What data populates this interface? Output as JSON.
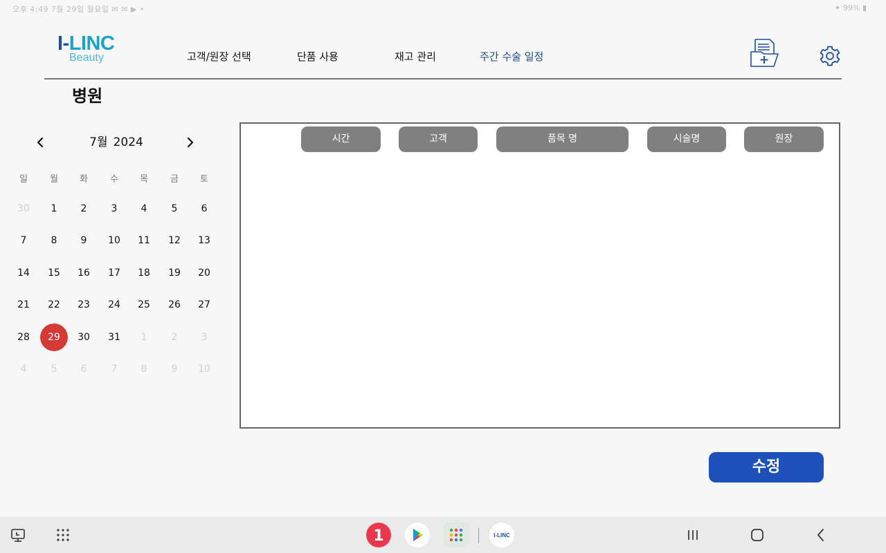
{
  "status_bar": {
    "left_text": "오후 4:49  7월 29일 월요일  ✉ ✉ ▶ •",
    "right_text": "✦ 99% ▮"
  },
  "logo": {
    "main_dark": "I-",
    "main_light": "LINC",
    "sub": "Beauty"
  },
  "nav": {
    "items": [
      {
        "label": "고객/원장 선택"
      },
      {
        "label": "단품 사용"
      },
      {
        "label": "재고 관리"
      },
      {
        "label": "주간 수술 일정"
      }
    ],
    "active_index": 3
  },
  "header_icons": [
    "medical-document-icon",
    "gear-icon"
  ],
  "page": {
    "title": "병원"
  },
  "calendar": {
    "month_label": "7월",
    "year_label": "2024",
    "weekdays": [
      "일",
      "월",
      "화",
      "수",
      "목",
      "금",
      "토"
    ],
    "weeks": [
      [
        "30",
        "1",
        "2",
        "3",
        "4",
        "5",
        "6"
      ],
      [
        "7",
        "8",
        "9",
        "10",
        "11",
        "12",
        "13"
      ],
      [
        "14",
        "15",
        "16",
        "17",
        "18",
        "19",
        "20"
      ],
      [
        "21",
        "22",
        "23",
        "24",
        "25",
        "26",
        "27"
      ],
      [
        "28",
        "29",
        "30",
        "31",
        "1",
        "2",
        "3"
      ],
      [
        "4",
        "5",
        "6",
        "7",
        "8",
        "9",
        "10"
      ]
    ],
    "selected_day": "29",
    "selected_color": "#d33a35"
  },
  "table": {
    "columns": [
      "시간",
      "고객",
      "품목 명",
      "시술명",
      "원장"
    ],
    "rows": []
  },
  "actions": {
    "edit_label": "수정",
    "edit_color": "#1e50b9"
  },
  "taskbar": {
    "left_icons": [
      "recent-screens-icon",
      "app-drawer-icon"
    ],
    "apps": [
      {
        "name": "one-app-icon",
        "glyph": "1"
      },
      {
        "name": "play-store-icon"
      },
      {
        "name": "apps-folder-icon"
      },
      {
        "name": "ilinc-app-icon",
        "label": "I-LINC"
      }
    ],
    "system_icons": [
      "recents-button-icon",
      "home-button-icon",
      "back-button-icon"
    ]
  }
}
